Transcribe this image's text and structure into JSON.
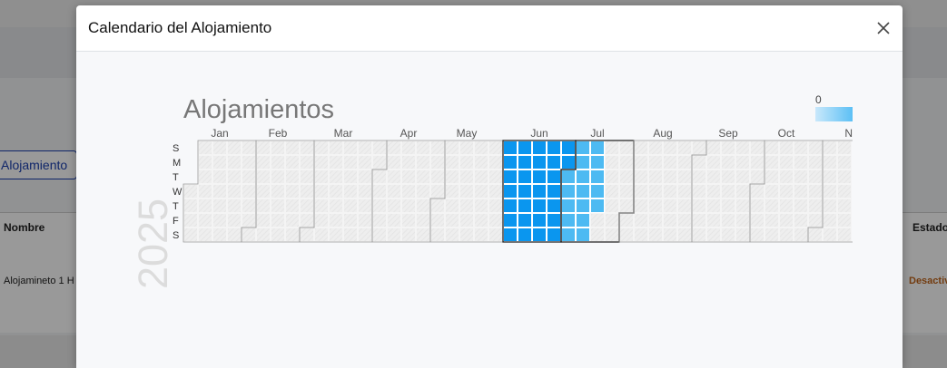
{
  "background": {
    "button_label": "Alojamiento",
    "table_header_nombre": "Nombre",
    "table_header_estado": "Estado",
    "row_nombre": "Alojamineto 1 H",
    "row_estado": "Desactiv"
  },
  "modal": {
    "title": "Calendario del Alojamiento",
    "close_icon": "close-icon"
  },
  "chart_data": {
    "type": "heatmap",
    "title": "Alojamientos",
    "year": "2025",
    "months": [
      "Jan",
      "Feb",
      "Mar",
      "Apr",
      "May",
      "Jun",
      "Jul",
      "Aug",
      "Sep",
      "Oct",
      "No"
    ],
    "weekday_labels": [
      "S",
      "M",
      "T",
      "W",
      "T",
      "F",
      "S"
    ],
    "legend": {
      "min_label": "0",
      "colors": [
        "#c9e8fb",
        "#5cc0f5"
      ]
    },
    "colors": {
      "empty": "#eeeeee",
      "dark": "#0a96ef",
      "light": "#4dbaf2",
      "month_border": "#9a9a9a",
      "highlight_border": "#222222"
    },
    "highlighted_months": [
      "Jun",
      "Jul"
    ],
    "filled_ranges": [
      {
        "from": "2025-06-01",
        "to": "2025-06-30",
        "shade": "dark"
      },
      {
        "from": "2025-07-01",
        "to": "2025-07-17",
        "shade": "light"
      }
    ]
  }
}
